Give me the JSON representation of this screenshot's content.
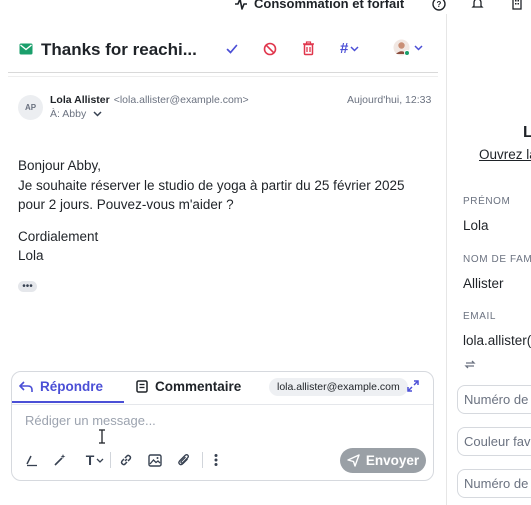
{
  "topbar": {
    "plan_label": "Consommation et forfait"
  },
  "conversation": {
    "title": "Thanks for reachi...",
    "status_color": "#1a9f6b",
    "accent_color": "#4b4fd6",
    "danger_color": "#e0364c"
  },
  "message": {
    "avatar_initials": "AP",
    "sender_name": "Lola Allister",
    "sender_email": "<lola.allister@example.com>",
    "to_label": "À: Abby",
    "timestamp": "Aujourd'hui, 12:33",
    "body": {
      "greeting": "Bonjour Abby,",
      "text": "Je souhaite réserver le studio de yoga à partir du 25 février 2025 pour 2 jours. Pouvez-vous m'aider ?",
      "closing": "Cordialement",
      "signature": "Lola"
    },
    "more_label": "•••"
  },
  "composer": {
    "reply_tab": "Répondre",
    "comment_tab": "Commentaire",
    "from_address": "lola.allister@example.com",
    "placeholder": "Rédiger un message...",
    "send_label": "Envoyer"
  },
  "sidebar": {
    "header_letter": "L",
    "open_link": "Ouvrez la",
    "fields": [
      {
        "label": "PRÉNOM",
        "value": "Lola"
      },
      {
        "label": "NOM DE FAM",
        "value": "Allister"
      },
      {
        "label": "EMAIL",
        "value": "lola.allister("
      }
    ],
    "inputs": [
      "Numéro de",
      "Couleur fav",
      "Numéro de"
    ]
  }
}
